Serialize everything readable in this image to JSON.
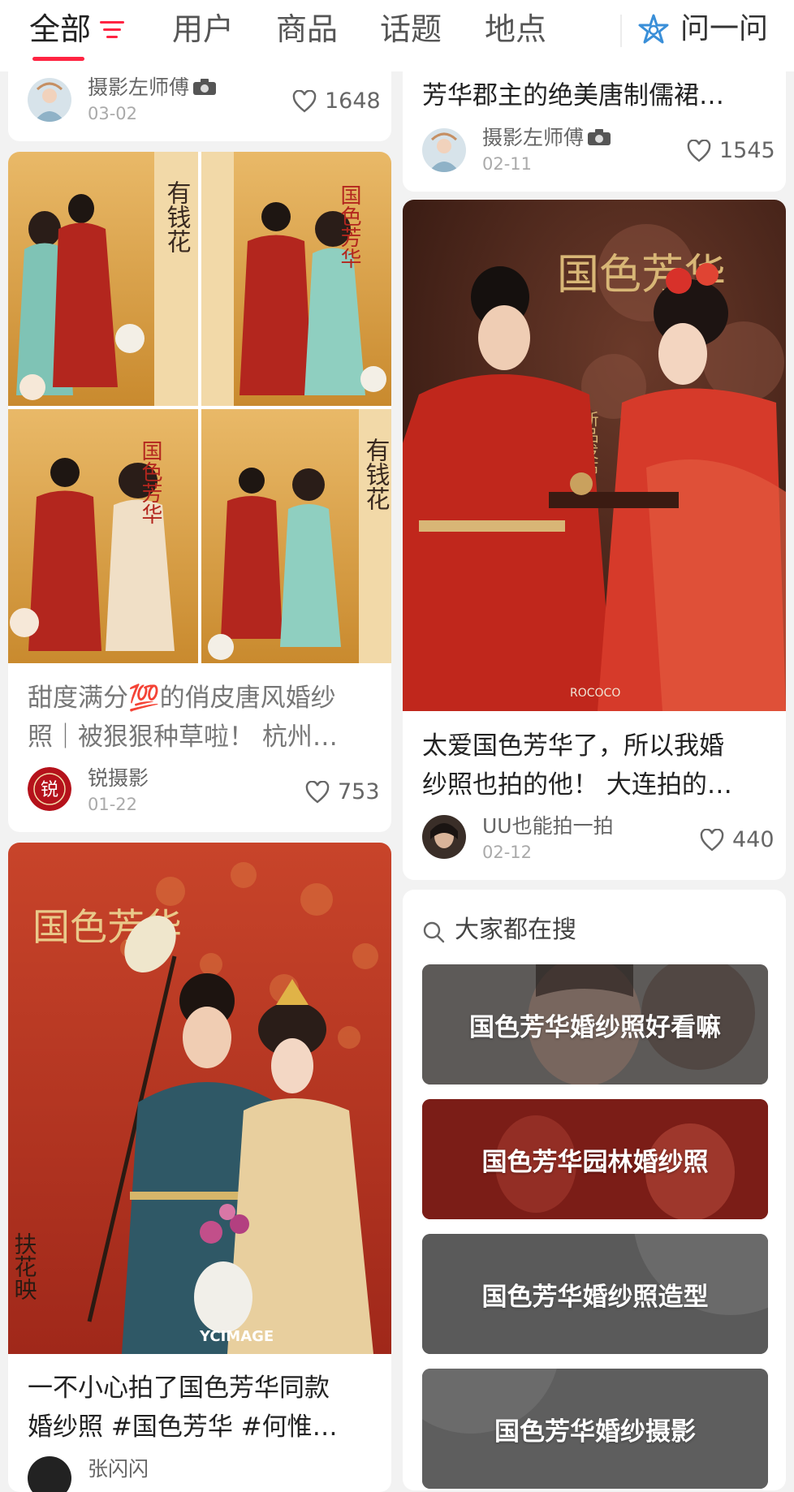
{
  "tabs": [
    {
      "label": "全部"
    },
    {
      "label": "用户"
    },
    {
      "label": "商品"
    },
    {
      "label": "话题"
    },
    {
      "label": "地点"
    }
  ],
  "ask": {
    "label": "问一问"
  },
  "colors": {
    "accent": "#ff2442",
    "tab_active": "#222222",
    "tab_inactive": "#555555"
  },
  "cards": [
    {
      "author": "摄影左师傅",
      "date": "03-02",
      "likes": "1648"
    },
    {
      "title": "芳华郡主的绝美唐制儒裙…",
      "author": "摄影左师傅",
      "date": "02-11",
      "likes": "1545"
    },
    {
      "title_line1": "甜度满分💯的俏皮唐风婚纱",
      "title_line2": "照｜被狠狠种草啦！ 杭州…",
      "author": "锐摄影",
      "date": "01-22",
      "likes": "753"
    },
    {
      "title_line1": "太爱国色芳华了，所以我婚",
      "title_line2": "纱照也拍的他！ 大连拍的…",
      "author": "UU也能拍一拍",
      "date": "02-12",
      "likes": "440"
    },
    {
      "title_line1": "一不小心拍了国色芳华同款",
      "title_line2": "婚纱照 #国色芳华 #何惟…",
      "author": "张闪闪"
    }
  ],
  "search": {
    "heading": "大家都在搜",
    "suggestions": [
      "国色芳华婚纱照好看嘛",
      "国色芳华园林婚纱照",
      "国色芳华婚纱照造型",
      "国色芳华婚纱摄影"
    ]
  },
  "image_text": {
    "poster_title": "国色芳华",
    "poster_sub": "新品发布",
    "brand_a": "ROCOCO",
    "brand_b": "YCIMAGE",
    "caption_a": "有钱花",
    "caption_b": "扶花映"
  }
}
